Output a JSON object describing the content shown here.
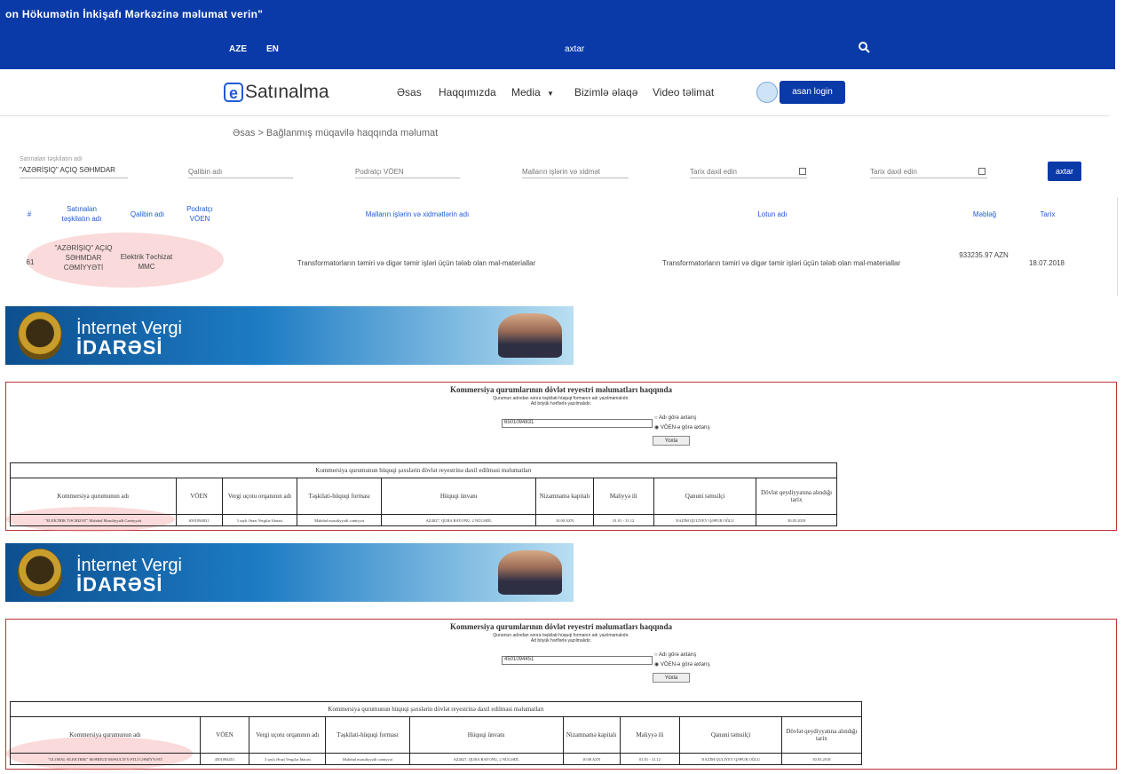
{
  "header": {
    "marquee": "on Hökumətin İnkişafı Mərkəzinə məlumat verin\"",
    "lang_aze": "AZE",
    "lang_en": "EN",
    "search_value": "axtar"
  },
  "nav": {
    "logo_e": "e",
    "logo_text": "Satınalma",
    "items": [
      "Əsas",
      "Haqqımızda",
      "Media",
      "Bizimlə əlaqə",
      "Video təlimat"
    ],
    "login": "asan login"
  },
  "breadcrumb": "Əsas > Bağlanmış müqavilə haqqında məlumat",
  "filters": {
    "org_label": "Satınalan təşkilatın adı",
    "org_value": "\"AZƏRİŞIQ\" AÇIQ SƏHMDAR",
    "winner_ph": "Qalibin adı",
    "voen_ph": "Podratçı VÖEN",
    "goods_ph": "Malların işlərin və xidmət",
    "date1_ph": "Tarix daxil edin",
    "date2_ph": "Tarix daxil edin",
    "search_btn": "axtar"
  },
  "results": {
    "headers": [
      "#",
      "Satınalan təşkilatın adı",
      "Qalibin adı",
      "Podratçı VÖEN",
      "Malların işlərin və xidmətlərin adı",
      "Lotun adı",
      "Məbləğ",
      "Tarix"
    ],
    "row": {
      "num": "61",
      "org": "\"AZƏRİŞIQ\" AÇIQ SƏHMDAR CƏMİYYƏTİ",
      "winner": "Elektrik Təchizat MMC",
      "voen": "",
      "goods": "Transformatorların təmiri və digər təmir işləri üçün tələb olan mal-materiallar",
      "lot": "Transformatorların təmiri və digər təmir işləri üçün tələb olan mal-materiallar",
      "amount": "933235.97 AZN",
      "date": "18.07.2018"
    }
  },
  "banner": {
    "title1": "İnternet Vergi",
    "title2": "İDARƏSİ"
  },
  "registry1": {
    "title": "Kommersiya qurumlarının dövlət reyestri məlumatları haqqında",
    "sub1": "Qurumun adından sonra təşkilati-hüquqi formanın adı yazılmamalıdır.",
    "sub2": "Ad böyük hərflərlə yazılmalıdır.",
    "input_value": "6501094831",
    "radio1": "Adı görə axtarış",
    "radio2": "VÖEN-ə görə axtarış",
    "yoxla": "Yoxla",
    "table_caption": "Kommersiya qurumunun hüquqi şəxslərin dövlət reyestrinə daxil edilməsi məlumatları",
    "headers": [
      "Kommersiya qurumunun adı",
      "VÖEN",
      "Vergi uçotu orqanının adı",
      "Təşkilati-hüquqi forması",
      "Hüquqi ünvanı",
      "Nizamnamə kapitalı",
      "Maliyyə ili",
      "Qanuni təmsilçi",
      "Dövlət qeydiyyatına alındığı tarix"
    ],
    "row": [
      "\"ELEKTRIK TƏCHIZAT\" Məhdud Məsuliyyətli Cəmiyyəti",
      "6501094831",
      "3 saylı Ərazi Vergilər İdarəsi",
      "Məhdud məsuliyyətli cəmiyyət",
      "AZ4027, QUBA RAYONU, 2 NÜGƏDİ,",
      "10.00 AZN",
      "01.01 - 31.12",
      "NAZİM QULİYEV QƏFUR OĞLU",
      "30.05.2018"
    ]
  },
  "registry2": {
    "title": "Kommersiya qurumlarının dövlət reyestri məlumatları haqqında",
    "sub1": "Qurumun adından sonra təşkilati-hüquqi formanın adı yazılmamalıdır.",
    "sub2": "Ad böyük hərflərlə yazılmalıdır.",
    "input_value": "4501094451",
    "radio1": "Adı görə axtarış",
    "radio2": "VÖEN-ə görə axtarış",
    "yoxla": "Yoxla",
    "table_caption": "Kommersiya qurumunun hüquqi şəxslərin dövlət reyestrinə daxil edilməsi məlumatları",
    "headers": [
      "Kommersiya qurumunun adı",
      "VÖEN",
      "Vergi uçotu orqanının adı",
      "Təşkilati-hüquqi forması",
      "Hüquqi ünvanı",
      "Nizamnamə kapitalı",
      "Maliyyə ili",
      "Qanuni təmsilçi",
      "Dövlət qeydiyyatına alındığı tarix"
    ],
    "row": [
      "\"GLOBAL-ELEKTRIK\" MƏHDUD MƏSULİYYƏTLİ CƏMİYYƏTİ",
      "4501094451",
      "3 saylı Ərazi Vergilər İdarəsi",
      "Məhdud məsuliyyətli cəmiyyət",
      "AZ4027, QUBA RAYONU, 2 NÜGƏDİ,",
      "10.00 AZN",
      "01.01 - 31.12",
      "NAZİM QULİYEV QƏFUR OĞLU",
      "30.05.2018"
    ]
  }
}
